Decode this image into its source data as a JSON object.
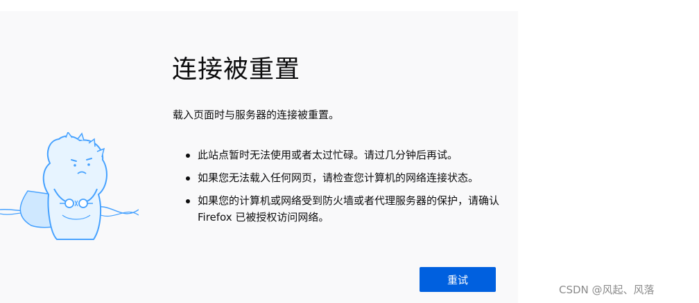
{
  "error": {
    "title": "连接被重置",
    "description": "载入页面时与服务器的连接被重置。",
    "tips": [
      "此站点暂时无法使用或者太过忙碌。请过几分钟后再试。",
      "如果您无法载入任何网页，请检查您计算机的网络连接状态。",
      "如果您的计算机或网络受到防火墙或者代理服务器的保护，请确认 Firefox 已被授权访问网络。"
    ],
    "retry_label": "重试"
  },
  "watermark": "CSDN @风起、风落",
  "colors": {
    "panel_bg": "#f9f9fa",
    "button": "#0060df",
    "illustration_stroke": "#45a1ff",
    "illustration_fill": "#e7f4ff"
  },
  "illustration_icon": "disconnected-plug-dinosaur-icon"
}
